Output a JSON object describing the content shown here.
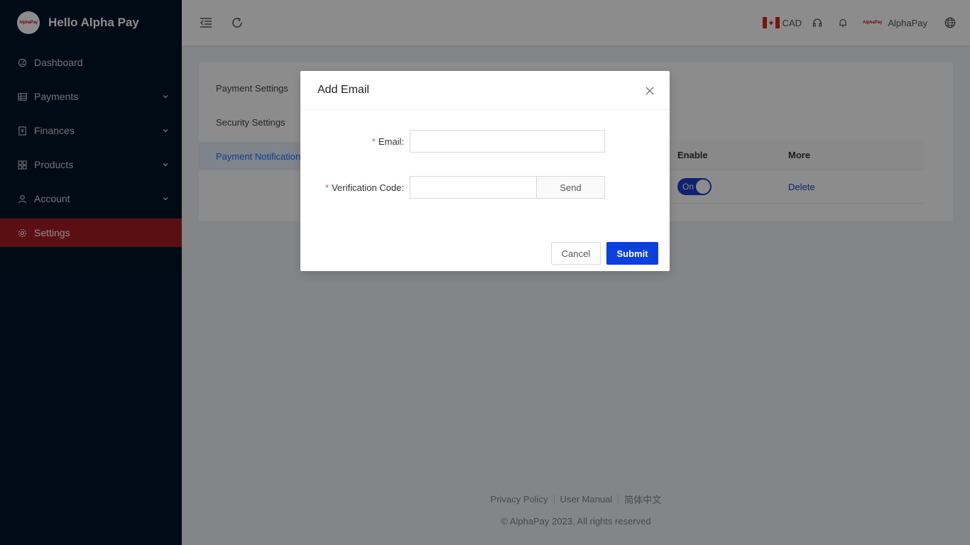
{
  "sidebar": {
    "brand_logo_text": "AlphaPay",
    "brand_title": "Hello Alpha Pay",
    "items": [
      {
        "label": "Dashboard",
        "icon": "dashboard-icon"
      },
      {
        "label": "Payments",
        "icon": "table-icon"
      },
      {
        "label": "Finances",
        "icon": "finance-icon"
      },
      {
        "label": "Products",
        "icon": "products-icon"
      },
      {
        "label": "Account",
        "icon": "user-icon"
      },
      {
        "label": "Settings",
        "icon": "gear-icon",
        "active": true
      }
    ]
  },
  "header": {
    "currency": "CAD",
    "user_logo_text": "AlphaPay",
    "user_name": "AlphaPay"
  },
  "settings_tabs": [
    {
      "label": "Payment Settings"
    },
    {
      "label": "Security Settings"
    },
    {
      "label": "Payment Notification",
      "active": true
    }
  ],
  "table": {
    "headers": [
      "Enable",
      "More"
    ],
    "rows": [
      {
        "enable": "On",
        "more": "Delete"
      }
    ]
  },
  "modal": {
    "title": "Add Email",
    "email_label": "Email",
    "code_label": "Verification Code",
    "send_label": "Send",
    "cancel_label": "Cancel",
    "submit_label": "Submit"
  },
  "footer": {
    "links": [
      "Privacy Policy",
      "User Manual",
      "简体中文"
    ],
    "copyright": "© AlphaPay 2023. All rights reserved"
  },
  "colors": {
    "sidebar_bg": "#001529",
    "active_menu": "#a61d24",
    "primary": "#0b3fe0"
  }
}
